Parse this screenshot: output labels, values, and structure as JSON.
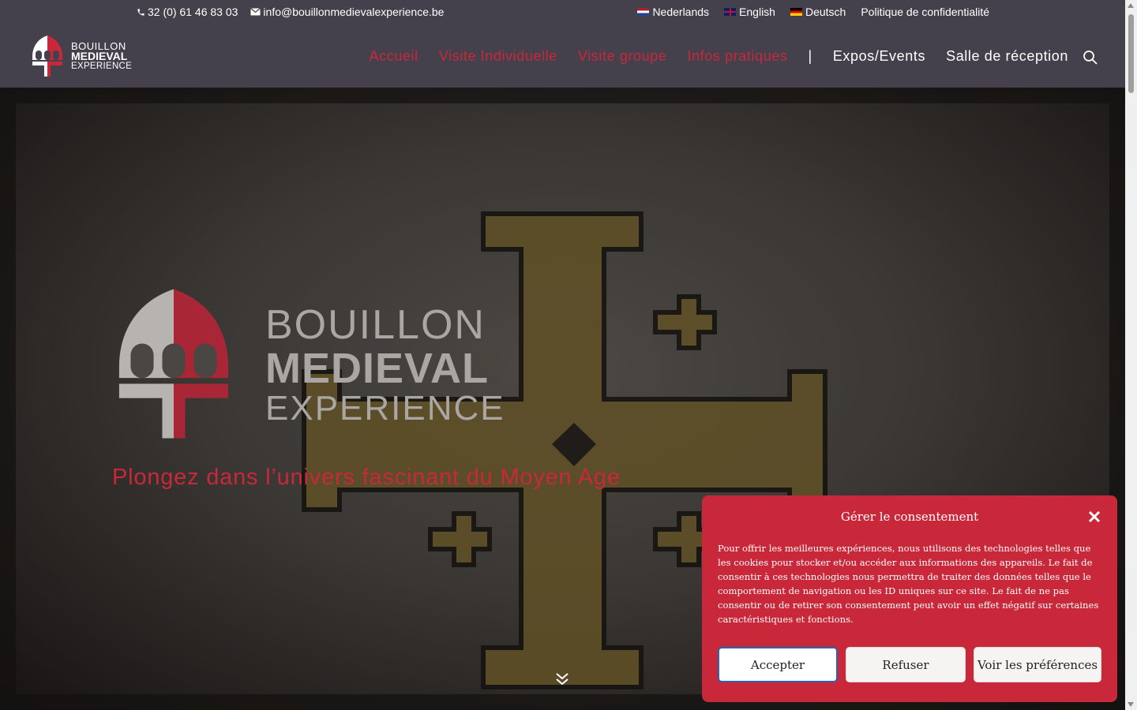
{
  "topbar": {
    "phone": "32 (0) 61 46 83 03",
    "email": "info@bouillonmedievalexperience.be",
    "languages": [
      {
        "label": "Nederlands",
        "flag": "nl-flag-icon"
      },
      {
        "label": "English",
        "flag": "uk-flag-icon"
      },
      {
        "label": "Deutsch",
        "flag": "de-flag-icon"
      }
    ],
    "privacy": "Politique de confidentialité"
  },
  "logo": {
    "line1": "BOUILLON",
    "line2": "MEDIEVAL",
    "line3": "EXPERIENCE"
  },
  "nav": {
    "items": [
      {
        "label": "Accueil"
      },
      {
        "label": "Visite Individuelle"
      },
      {
        "label": "Visite groupe"
      },
      {
        "label": "Infos pratiques"
      },
      {
        "label": "|"
      },
      {
        "label": "Expos/Events"
      },
      {
        "label": "Salle de réception"
      }
    ]
  },
  "hero": {
    "brand_line1": "BOUILLON",
    "brand_line2": "MEDIEVAL",
    "brand_line3": "EXPERIENCE",
    "tagline": "Plongez dans l’univers fascinant du Moyen Age"
  },
  "consent": {
    "title": "Gérer le consentement",
    "body": "Pour offrir les meilleures expériences, nous utilisons des technologies telles que les cookies pour stocker et/ou accéder aux informations des appareils. Le fait de consentir à ces technologies nous permettra de traiter des données telles que le comportement de navigation ou les ID uniques sur ce site. Le fait de ne pas consentir ou de retirer son consentement peut avoir un effet négatif sur certaines caractéristiques et fonctions.",
    "accept": "Accepter",
    "refuse": "Refuser",
    "preferences": "Voir les préférences"
  },
  "colors": {
    "accent": "#c8283a",
    "header_bg": "#44414d"
  }
}
